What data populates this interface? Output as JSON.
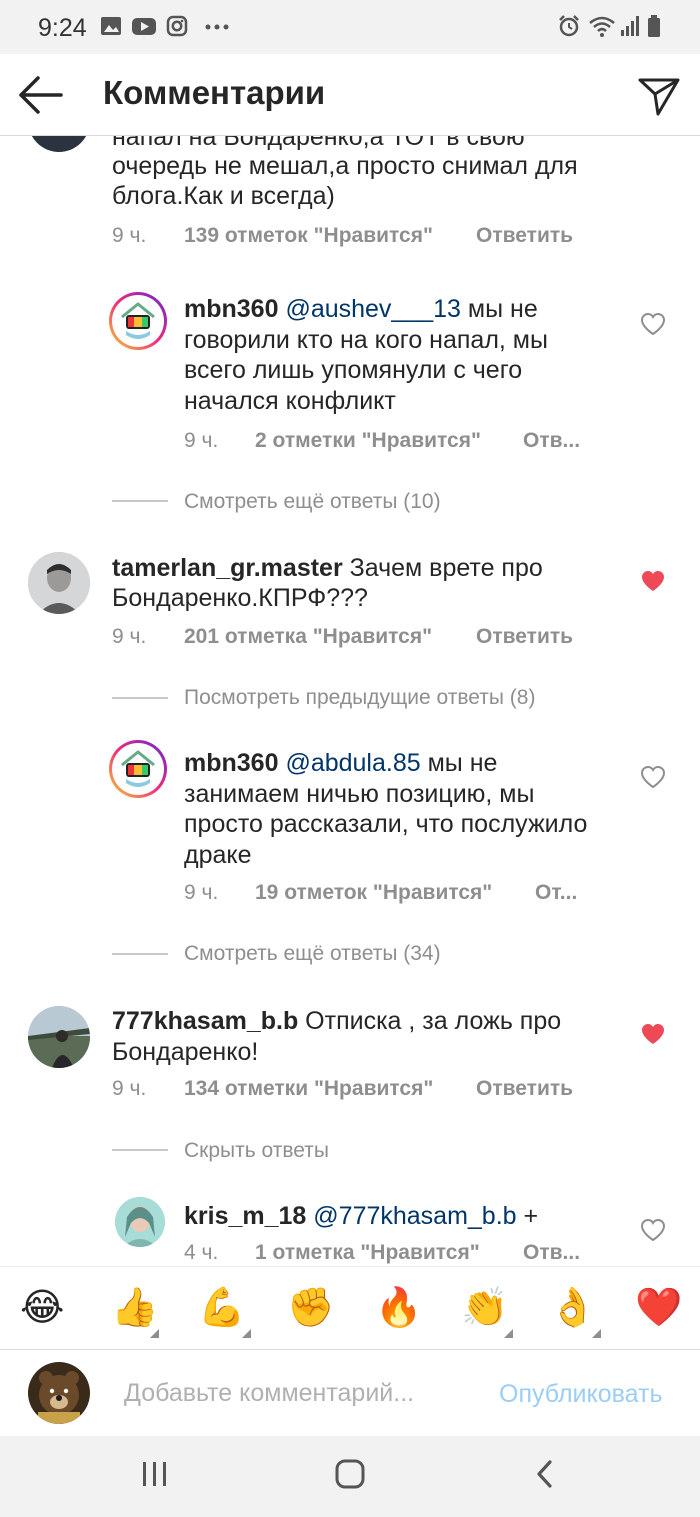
{
  "status_bar": {
    "time": "9:24",
    "left_icons": [
      "gallery-icon",
      "youtube-icon",
      "instagram-icon",
      "more-dots-icon"
    ],
    "right_icons": [
      "alarm-icon",
      "wifi-icon",
      "signal-icon",
      "battery-icon"
    ]
  },
  "header": {
    "title": "Комментарии",
    "back_icon": "arrow-left-icon",
    "send_icon": "paper-plane-icon"
  },
  "comments": [
    {
      "text_lines": [
        "напал на Бондаренко,а ТОТ в свою",
        "очередь не мешал,а просто снимал для",
        "блога.Как и всегда)"
      ],
      "time": "9 ч.",
      "likes": "139 отметок \"Нравится\"",
      "reply": "Ответить"
    },
    {
      "username": "mbn360",
      "mention": "@aushev___13",
      "text_line1": "мы не",
      "text_lines": [
        "говорили кто на кого напал, мы",
        "всего лишь упомянули с чего",
        "начался конфликт"
      ],
      "time": "9 ч.",
      "likes": "2 отметки \"Нравится\"",
      "reply": "Отв..."
    },
    {
      "more_replies": "Смотреть ещё ответы (10)"
    },
    {
      "username": "tamerlan_gr.master",
      "text_line1": "Зачем врете про",
      "text_lines": [
        "Бондаренко.КПРФ???"
      ],
      "time": "9 ч.",
      "likes": "201 отметка \"Нравится\"",
      "reply": "Ответить",
      "liked": true
    },
    {
      "more_replies": "Посмотреть предыдущие ответы (8)"
    },
    {
      "username": "mbn360",
      "mention": "@abdula.85",
      "text_line1": "мы не",
      "text_lines": [
        "занимаем ничью позицию, мы",
        "просто рассказали, что послужило",
        "драке"
      ],
      "time": "9 ч.",
      "likes": "19 отметок \"Нравится\"",
      "reply": "От..."
    },
    {
      "more_replies": "Смотреть ещё ответы (34)"
    },
    {
      "username": "777khasam_b.b",
      "text_line1": "Отписка , за ложь про",
      "text_lines": [
        "Бондаренко!"
      ],
      "time": "9 ч.",
      "likes": "134 отметки \"Нравится\"",
      "reply": "Ответить",
      "liked": true
    },
    {
      "more_replies": "Скрыть ответы"
    },
    {
      "username": "kris_m_18",
      "mention": "@777khasam_b.b",
      "text_line1": "+",
      "time": "4 ч.",
      "likes": "1 отметка \"Нравится\"",
      "reply": "Отв..."
    }
  ],
  "emoji_bar": [
    "😂",
    "👍",
    "💪",
    "✊",
    "🔥",
    "👏",
    "👌",
    "❤️"
  ],
  "composer": {
    "placeholder": "Добавьте комментарий...",
    "publish_label": "Опубликовать"
  },
  "nav_bar": {
    "recent_icon": "recent-apps-icon",
    "home_icon": "home-icon",
    "back_icon": "nav-back-icon"
  },
  "colors": {
    "accent_blue": "#9ccdf5",
    "mention_blue": "#003569",
    "like_red": "#ed4956",
    "secondary_text": "#8e8e8e"
  }
}
